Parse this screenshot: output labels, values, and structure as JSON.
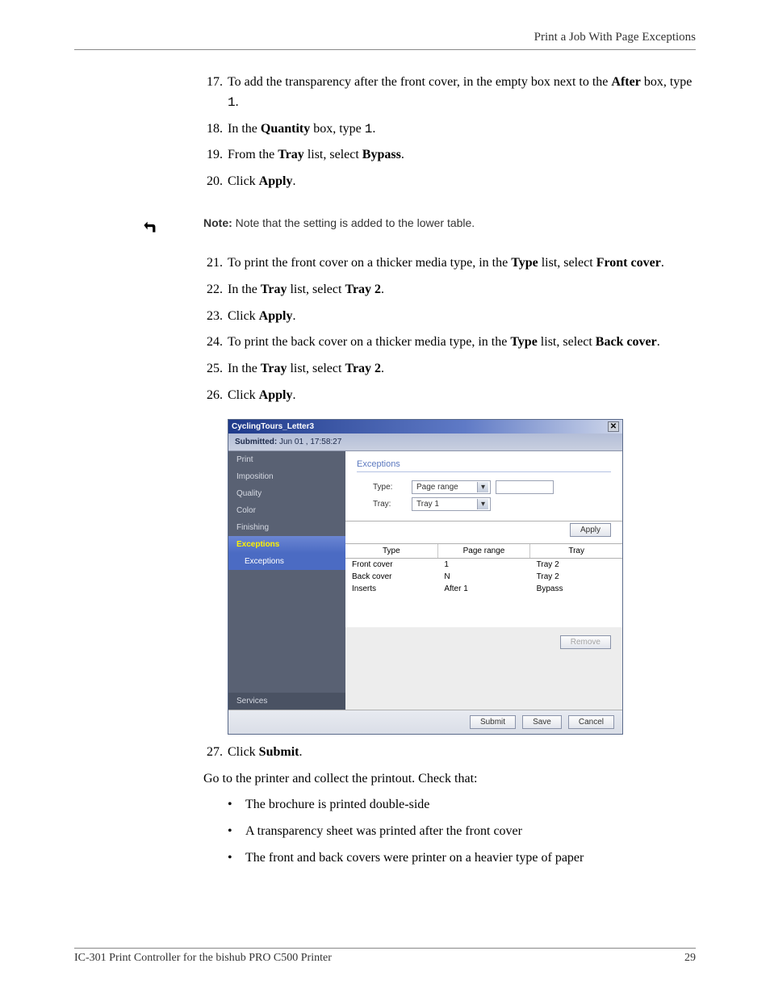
{
  "header": {
    "title": "Print a Job With Page Exceptions"
  },
  "steps_a": {
    "17": {
      "pre": "To add the transparency after the front cover, in the empty box next to the ",
      "bold": "After",
      "post": " box, type ",
      "mono": "1",
      "end": "."
    },
    "18": {
      "pre": "In the ",
      "bold": "Quantity",
      "post": " box, type ",
      "mono": "1",
      "end": "."
    },
    "19": {
      "pre": "From the ",
      "bold1": "Tray",
      "mid": " list, select ",
      "bold2": "Bypass",
      "end": "."
    },
    "20": {
      "pre": "Click ",
      "bold": "Apply",
      "end": "."
    }
  },
  "note": {
    "label": "Note:",
    "text": " Note that the setting is added to the lower table."
  },
  "steps_b": {
    "21": {
      "pre": "To print the front cover on a thicker media type, in the ",
      "bold1": "Type",
      "mid": " list, select ",
      "bold2": "Front cover",
      "end": "."
    },
    "22": {
      "pre": "In the ",
      "bold1": "Tray",
      "mid": " list, select ",
      "bold2": "Tray 2",
      "end": "."
    },
    "23": {
      "pre": "Click ",
      "bold": "Apply",
      "end": "."
    },
    "24": {
      "pre": "To print the back cover on a thicker media type, in the ",
      "bold1": "Type",
      "mid": " list, select ",
      "bold2": "Back cover",
      "end": "."
    },
    "25": {
      "pre": "In the ",
      "bold1": "Tray",
      "mid": " list, select ",
      "bold2": "Tray 2",
      "end": "."
    },
    "26": {
      "pre": "Click ",
      "bold": "Apply",
      "end": "."
    }
  },
  "dlg": {
    "title": "CyclingTours_Letter3",
    "submitted_label": "Submitted:",
    "submitted_value": " Jun 01 , 17:58:27",
    "side": [
      "Print",
      "Imposition",
      "Quality",
      "Color",
      "Finishing"
    ],
    "side_active": "Exceptions",
    "side_sub": "Exceptions",
    "side_bottom": "Services",
    "sec_title": "Exceptions",
    "type_lbl": "Type:",
    "type_val": "Page range",
    "tray_lbl": "Tray:",
    "tray_val": "Tray 1",
    "apply": "Apply",
    "cols": [
      "Type",
      "Page range",
      "Tray"
    ],
    "rows": [
      {
        "type": "Front cover",
        "range": "1",
        "tray": "Tray 2"
      },
      {
        "type": "Back cover",
        "range": "N",
        "tray": "Tray 2"
      },
      {
        "type": "Inserts",
        "range": "After 1",
        "tray": "Bypass"
      }
    ],
    "remove": "Remove",
    "footer": {
      "submit": "Submit",
      "save": "Save",
      "cancel": "Cancel"
    }
  },
  "step27": {
    "pre": "Click ",
    "bold": "Submit",
    "end": "."
  },
  "after": "Go to the printer and collect the printout. Check that:",
  "checks": [
    "The brochure is printed double-side",
    "A transparency sheet was printed after the front cover",
    "The front and back covers were printer on a heavier type of paper"
  ],
  "footer": {
    "left": "IC-301 Print Controller for the bishub PRO C500 Printer",
    "right": "29"
  }
}
